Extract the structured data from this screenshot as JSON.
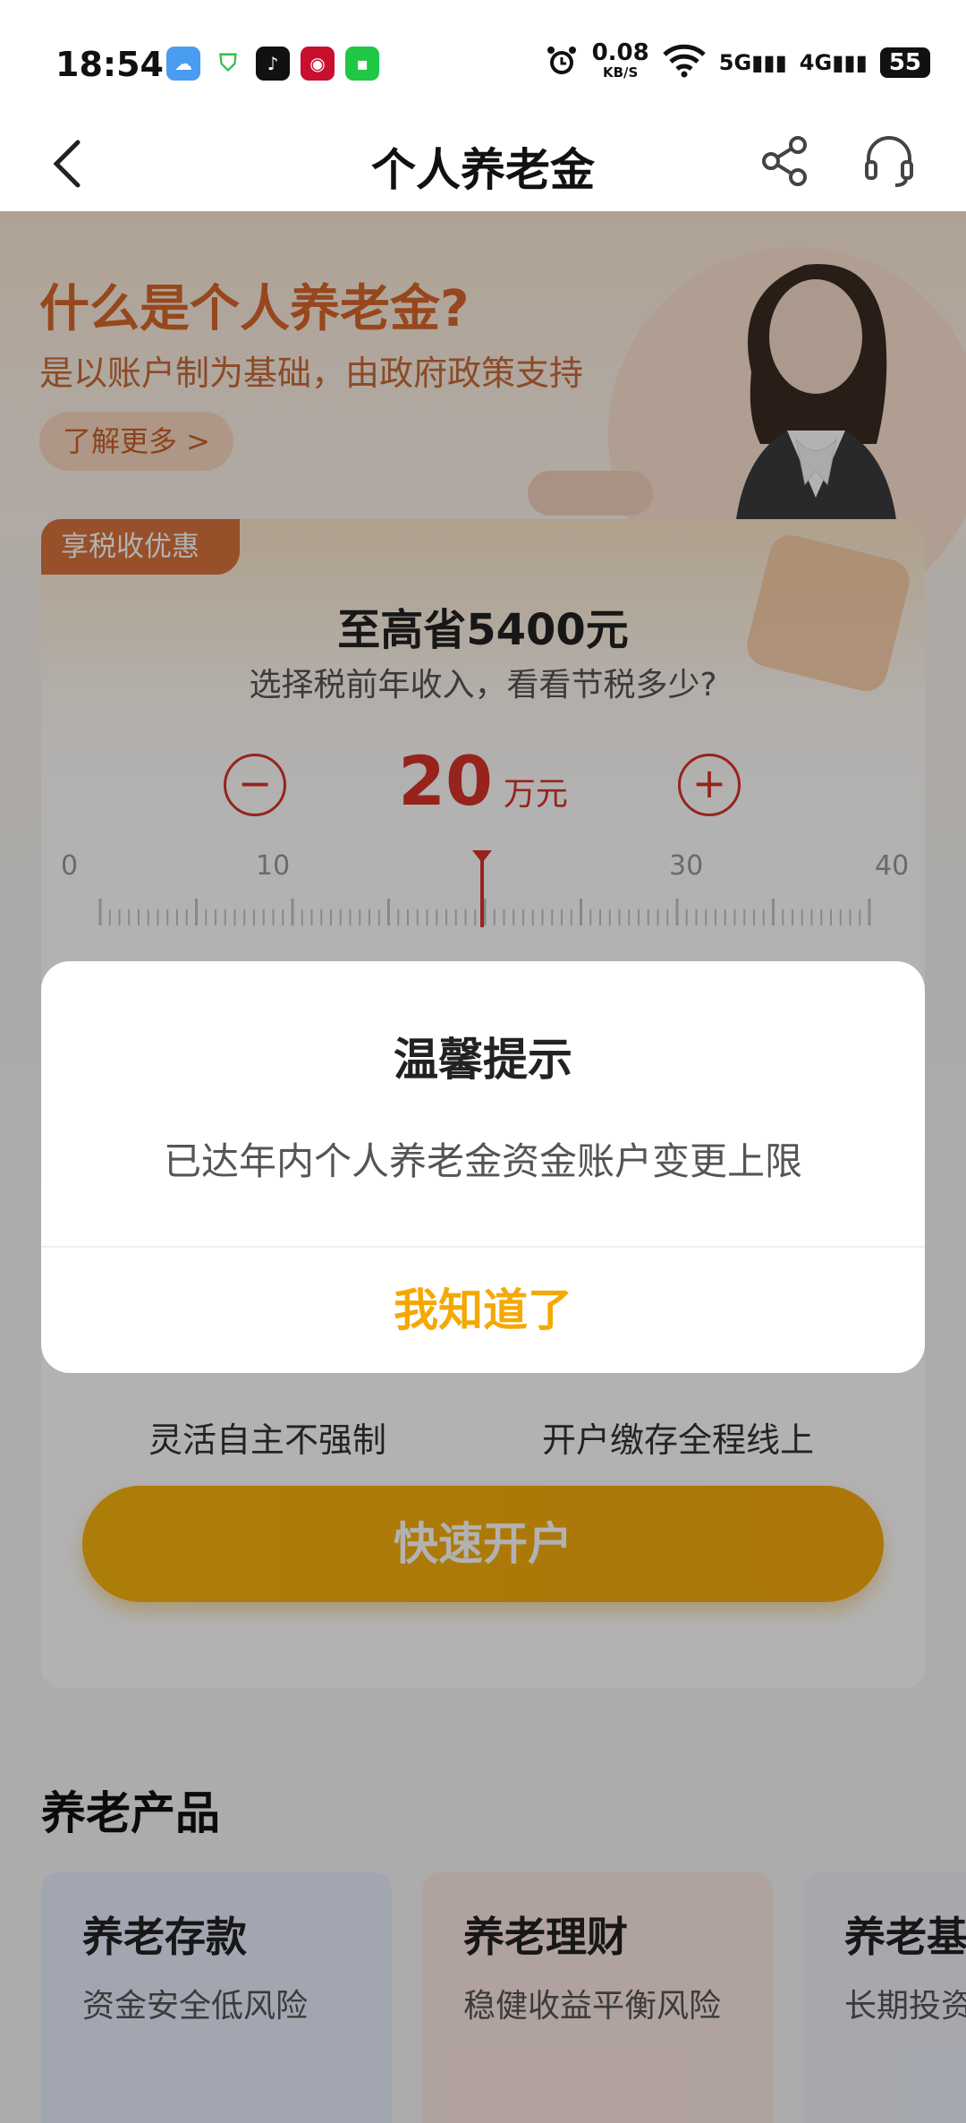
{
  "status_bar": {
    "time": "18:54",
    "net_speed": "0.08",
    "net_unit": "KB/S",
    "signal_5g": "5G",
    "signal_4g": "4G",
    "battery": "55"
  },
  "nav": {
    "title": "个人养老金"
  },
  "hero": {
    "title": "什么是个人养老金?",
    "subtitle": "是以账户制为基础，由政府政策支持",
    "more_label": "了解更多 >"
  },
  "tax_card": {
    "badge": "享税收优惠",
    "headline": "至高省5400元",
    "subtitle": "选择税前年收入，看看节税多少?",
    "income_value": "20",
    "income_unit": "万元",
    "ruler_labels": [
      "0",
      "10",
      "30",
      "40"
    ],
    "income_range": [
      0,
      40
    ],
    "income_selected": 20
  },
  "features": {
    "left": "灵活自主不强制",
    "right": "开户缴存全程线上"
  },
  "open_button_label": "快速开户",
  "products": {
    "section_title": "养老产品",
    "items": [
      {
        "name": "养老存款",
        "desc": "资金安全低风险",
        "color": "#e8eefc"
      },
      {
        "name": "养老理财",
        "desc": "稳健收益平衡风险",
        "color": "#fde8e2"
      },
      {
        "name": "养老基",
        "desc": "长期投资",
        "color": "#eef1fa"
      }
    ]
  },
  "dialog": {
    "title": "温馨提示",
    "message": "已达年内个人养老金资金账户变更上限",
    "confirm_label": "我知道了"
  },
  "colors": {
    "accent_orange": "#f5a800",
    "stepper_red": "#d9332a",
    "hero_orange": "#d8662a"
  }
}
